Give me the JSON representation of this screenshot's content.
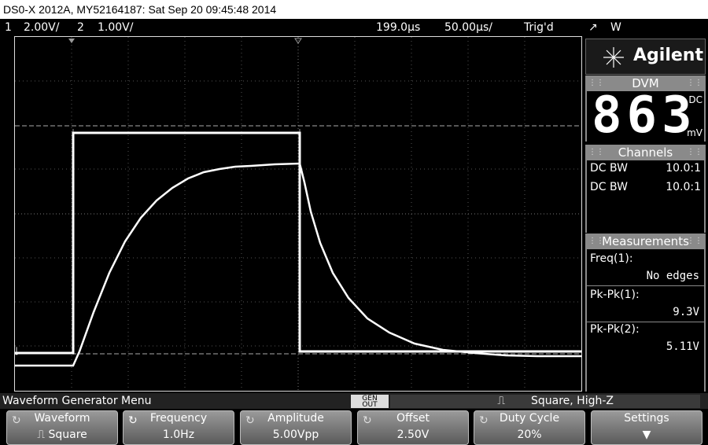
{
  "title": "DS0-X 2012A, MY52164187: Sat Sep 20 09:45:48 2014",
  "status": {
    "ch1_num": "1",
    "ch1_scale": "2.00V/",
    "ch2_num": "2",
    "ch2_scale": "1.00V/",
    "time_delay": "199.0µs",
    "time_scale": "50.00µs/",
    "trig_state": "Trig'd",
    "trig_source": "W"
  },
  "logo": {
    "brand": "Agilent"
  },
  "dvm": {
    "header": "DVM",
    "value": "863",
    "coupling": "DC",
    "unit": "mV"
  },
  "channels": {
    "header": "Channels",
    "rows": [
      {
        "left": "DC BW",
        "right": "10.0:1"
      },
      {
        "left": "DC BW",
        "right": "10.0:1"
      }
    ]
  },
  "measurements": {
    "header": "Measurements",
    "items": [
      {
        "label": "Freq(1):",
        "value": "No edges"
      },
      {
        "label": "Pk-Pk(1):",
        "value": "9.3V"
      },
      {
        "label": "Pk-Pk(2):",
        "value": "5.11V"
      }
    ]
  },
  "menu": {
    "title": "Waveform Generator Menu",
    "gen_out_line1": "GEN",
    "gen_out_line2": "OUT",
    "wave_summary": "Square, High-Z"
  },
  "softkeys": [
    {
      "title": "Waveform",
      "value": "Square"
    },
    {
      "title": "Frequency",
      "value": "1.0Hz"
    },
    {
      "title": "Amplitude",
      "value": "5.00Vpp"
    },
    {
      "title": "Offset",
      "value": "2.50V"
    },
    {
      "title": "Duty Cycle",
      "value": "20%"
    },
    {
      "title": "Settings",
      "value": ""
    }
  ],
  "colors": {
    "trace": "#ffffff",
    "grid": "#555555",
    "panel_header": "#8a8a8a"
  }
}
